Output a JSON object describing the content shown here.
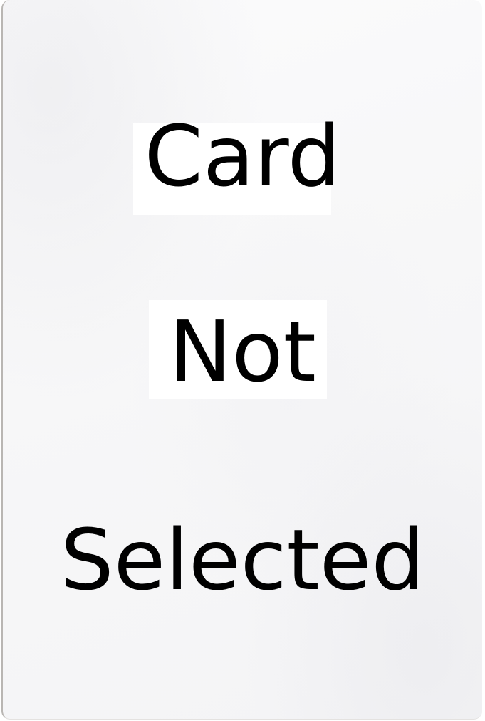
{
  "card": {
    "line1": "Card",
    "line2": "Not",
    "line3": "Selected"
  },
  "colors": {
    "text": "#000000",
    "card_background": "#f7f7f8",
    "card_edge": "#b9b6b3"
  }
}
